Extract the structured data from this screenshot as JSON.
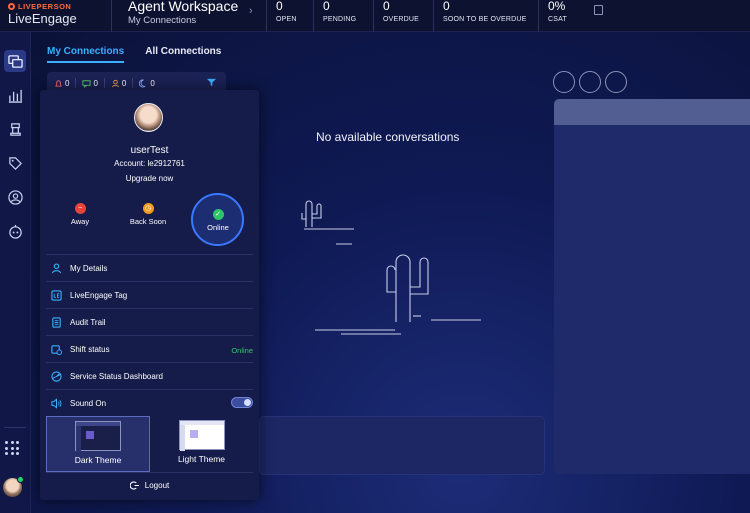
{
  "brand": {
    "company": "LIVEPERSON",
    "product": "LiveEngage"
  },
  "workspace": {
    "title": "Agent Workspace",
    "subtitle": "My Connections"
  },
  "stats": [
    {
      "value": "0",
      "label": "OPEN"
    },
    {
      "value": "0",
      "label": "PENDING"
    },
    {
      "value": "0",
      "label": "OVERDUE"
    },
    {
      "value": "0",
      "label": "SOON TO BE OVERDUE"
    },
    {
      "value": "0%",
      "label": "CSAT"
    }
  ],
  "tabs": [
    "My Connections",
    "All Connections"
  ],
  "filters": [
    "0",
    "0",
    "0",
    "0"
  ],
  "empty_message": "No available conversations",
  "profile": {
    "username": "userTest",
    "account": "Account: le2912761",
    "upgrade": "Upgrade now",
    "statuses": [
      {
        "label": "Away",
        "color": "#e8443b",
        "icon": "minus-icon"
      },
      {
        "label": "Back Soon",
        "color": "#f29a1d",
        "icon": "clock-icon"
      },
      {
        "label": "Online",
        "color": "#2fc46b",
        "icon": "check-icon"
      }
    ]
  },
  "menu": {
    "my_details": "My Details",
    "tag": "LiveEngage Tag",
    "audit": "Audit Trail",
    "shift": "Shift status",
    "shift_value": "Online",
    "service": "Service Status Dashboard",
    "sound": "Sound On"
  },
  "themes": {
    "dark": "Dark Theme",
    "light": "Light Theme"
  },
  "logout": "Logout",
  "colors": {
    "accent": "#39b0ff",
    "online": "#36c46a",
    "background": "#0b1238"
  }
}
